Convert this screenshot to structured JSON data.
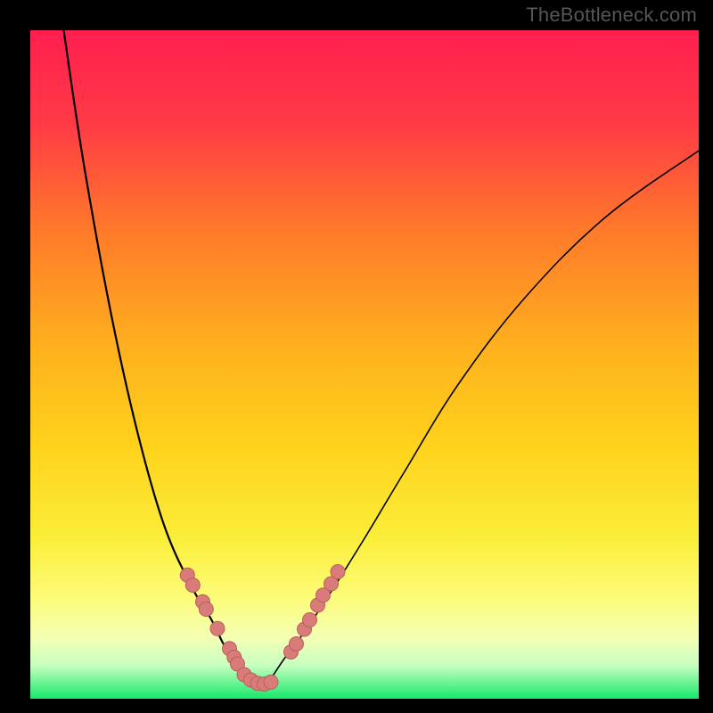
{
  "watermark": "TheBottleneck.com",
  "colors": {
    "frame": "#000000",
    "gradient_top": "#ff1f4f",
    "gradient_mid_upper": "#ff7a2a",
    "gradient_mid": "#ffd21c",
    "gradient_mid_lower": "#fff95a",
    "gradient_lower": "#f7ffab",
    "gradient_bottom": "#16e86a",
    "curve": "#000000",
    "dot_fill": "#d97c79",
    "dot_stroke": "#b85f5c"
  },
  "chart_data": {
    "type": "line",
    "title": "",
    "xlabel": "",
    "ylabel": "",
    "xlim": [
      0,
      100
    ],
    "ylim": [
      0,
      100
    ],
    "grid": false,
    "series": [
      {
        "name": "bottleneck-curve-left",
        "x": [
          5,
          8,
          12,
          16,
          20,
          24,
          27,
          29,
          31,
          32
        ],
        "values": [
          100,
          80,
          58,
          40,
          26,
          17,
          12,
          8,
          5,
          3
        ]
      },
      {
        "name": "bottleneck-curve-right",
        "x": [
          36,
          38,
          41,
          45,
          50,
          56,
          64,
          74,
          86,
          100
        ],
        "values": [
          3,
          6,
          10,
          16,
          24,
          34,
          47,
          60,
          72,
          82
        ]
      }
    ],
    "minimum_region_x": [
      32,
      36
    ],
    "annotations": [
      {
        "name": "marker-cluster-left",
        "points_xy": [
          [
            23.5,
            18.5
          ],
          [
            24.3,
            17.0
          ],
          [
            25.8,
            14.5
          ],
          [
            26.3,
            13.4
          ],
          [
            28.0,
            10.5
          ],
          [
            29.8,
            7.5
          ],
          [
            30.5,
            6.2
          ],
          [
            31.0,
            5.2
          ],
          [
            32.0,
            3.6
          ],
          [
            33.0,
            2.8
          ],
          [
            34.0,
            2.3
          ],
          [
            35.0,
            2.2
          ],
          [
            36.0,
            2.5
          ]
        ]
      },
      {
        "name": "marker-cluster-right",
        "points_xy": [
          [
            39.0,
            7.0
          ],
          [
            39.8,
            8.2
          ],
          [
            41.0,
            10.4
          ],
          [
            41.8,
            11.8
          ],
          [
            43.0,
            14.0
          ],
          [
            43.8,
            15.5
          ],
          [
            45.0,
            17.2
          ],
          [
            46.0,
            19.0
          ]
        ]
      }
    ]
  }
}
